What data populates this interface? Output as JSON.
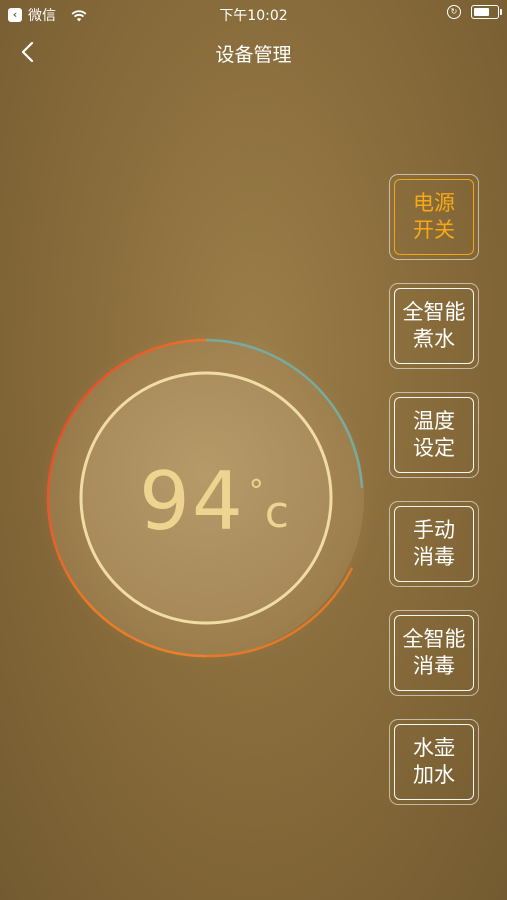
{
  "status_bar": {
    "back_app": "微信",
    "time": "下午10:02",
    "battery_level": 0.75
  },
  "nav": {
    "title": "设备管理",
    "back_icon": "chevron-left-icon"
  },
  "thermostat": {
    "value": "94",
    "unit_degree": "°",
    "unit_letter": "c",
    "arc_colors": [
      "#e5392c",
      "#ee7a26",
      "#6fb3b0"
    ]
  },
  "controls": [
    {
      "label": "电源\n开关",
      "active": true
    },
    {
      "label": "全智能\n煮水",
      "active": false
    },
    {
      "label": "温度\n设定",
      "active": false
    },
    {
      "label": "手动\n消毒",
      "active": false
    },
    {
      "label": "全智能\n消毒",
      "active": false
    },
    {
      "label": "水壶\n加水",
      "active": false
    }
  ],
  "colors": {
    "active_accent": "#f6a817",
    "temp_text": "#efd48f"
  }
}
